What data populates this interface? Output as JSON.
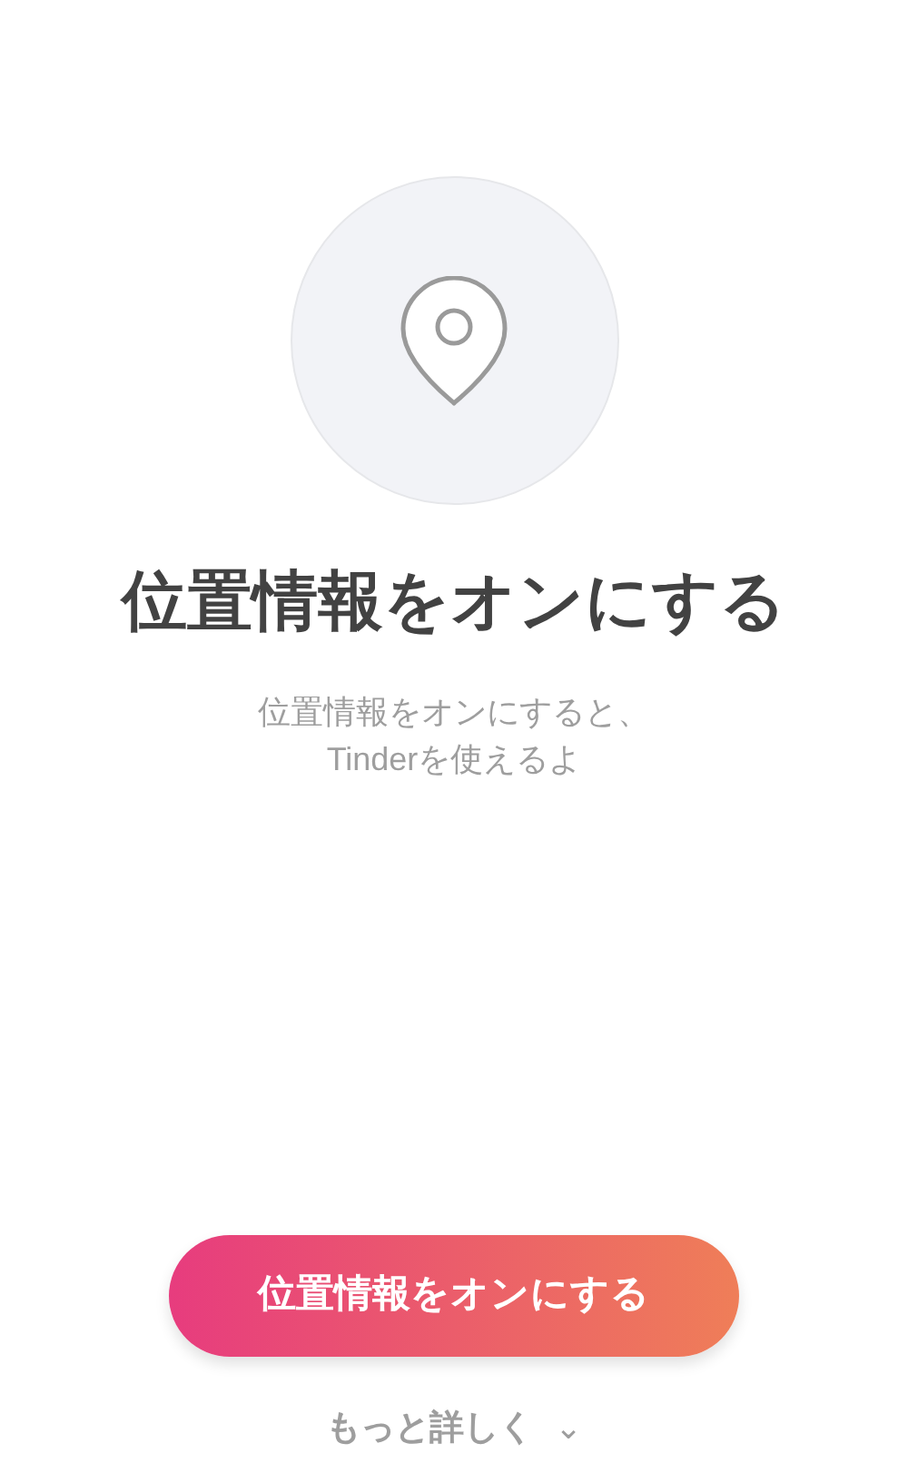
{
  "title": "位置情報をオンにする",
  "description": [
    "位置情報をオンにすると、",
    "Tinderを使えるよ"
  ],
  "primary_button": {
    "label": "位置情報をオンにする"
  },
  "more_link": {
    "label": "もっと詳しく",
    "caret": "⌄"
  }
}
